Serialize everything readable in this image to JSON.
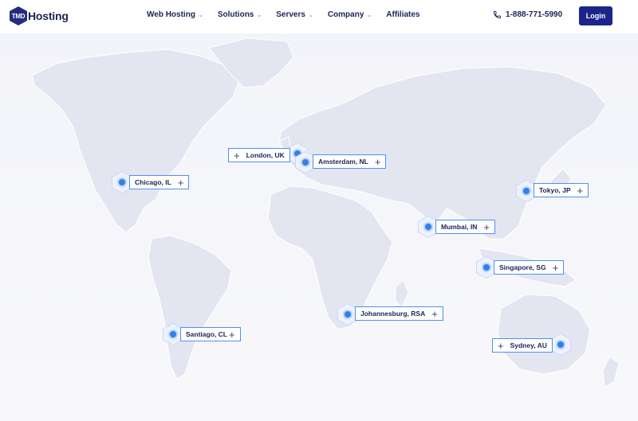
{
  "brand": {
    "badge": "TMD",
    "name": "Hosting"
  },
  "nav": [
    {
      "label": "Web Hosting",
      "dropdown": true
    },
    {
      "label": "Solutions",
      "dropdown": true
    },
    {
      "label": "Servers",
      "dropdown": true
    },
    {
      "label": "Company",
      "dropdown": true
    },
    {
      "label": "Affiliates",
      "dropdown": false
    }
  ],
  "phone": "1-888-771-5990",
  "login_label": "Login",
  "locations": [
    {
      "label": "London, UK"
    },
    {
      "label": "Amsterdam, NL"
    },
    {
      "label": "Chicago, IL"
    },
    {
      "label": "Tokyo, JP"
    },
    {
      "label": "Mumbai, IN"
    },
    {
      "label": "Singapore, SG"
    },
    {
      "label": "Johannesburg, RSA"
    },
    {
      "label": "Santiago, CL"
    },
    {
      "label": "Sydney, AU"
    }
  ],
  "icons": {
    "expand": "+",
    "chevron": "⌄"
  },
  "colors": {
    "primary": "#1b2589",
    "accent": "#2f80ed",
    "map_land": "#e4e7f2",
    "map_bg": "#f4f5f9"
  }
}
